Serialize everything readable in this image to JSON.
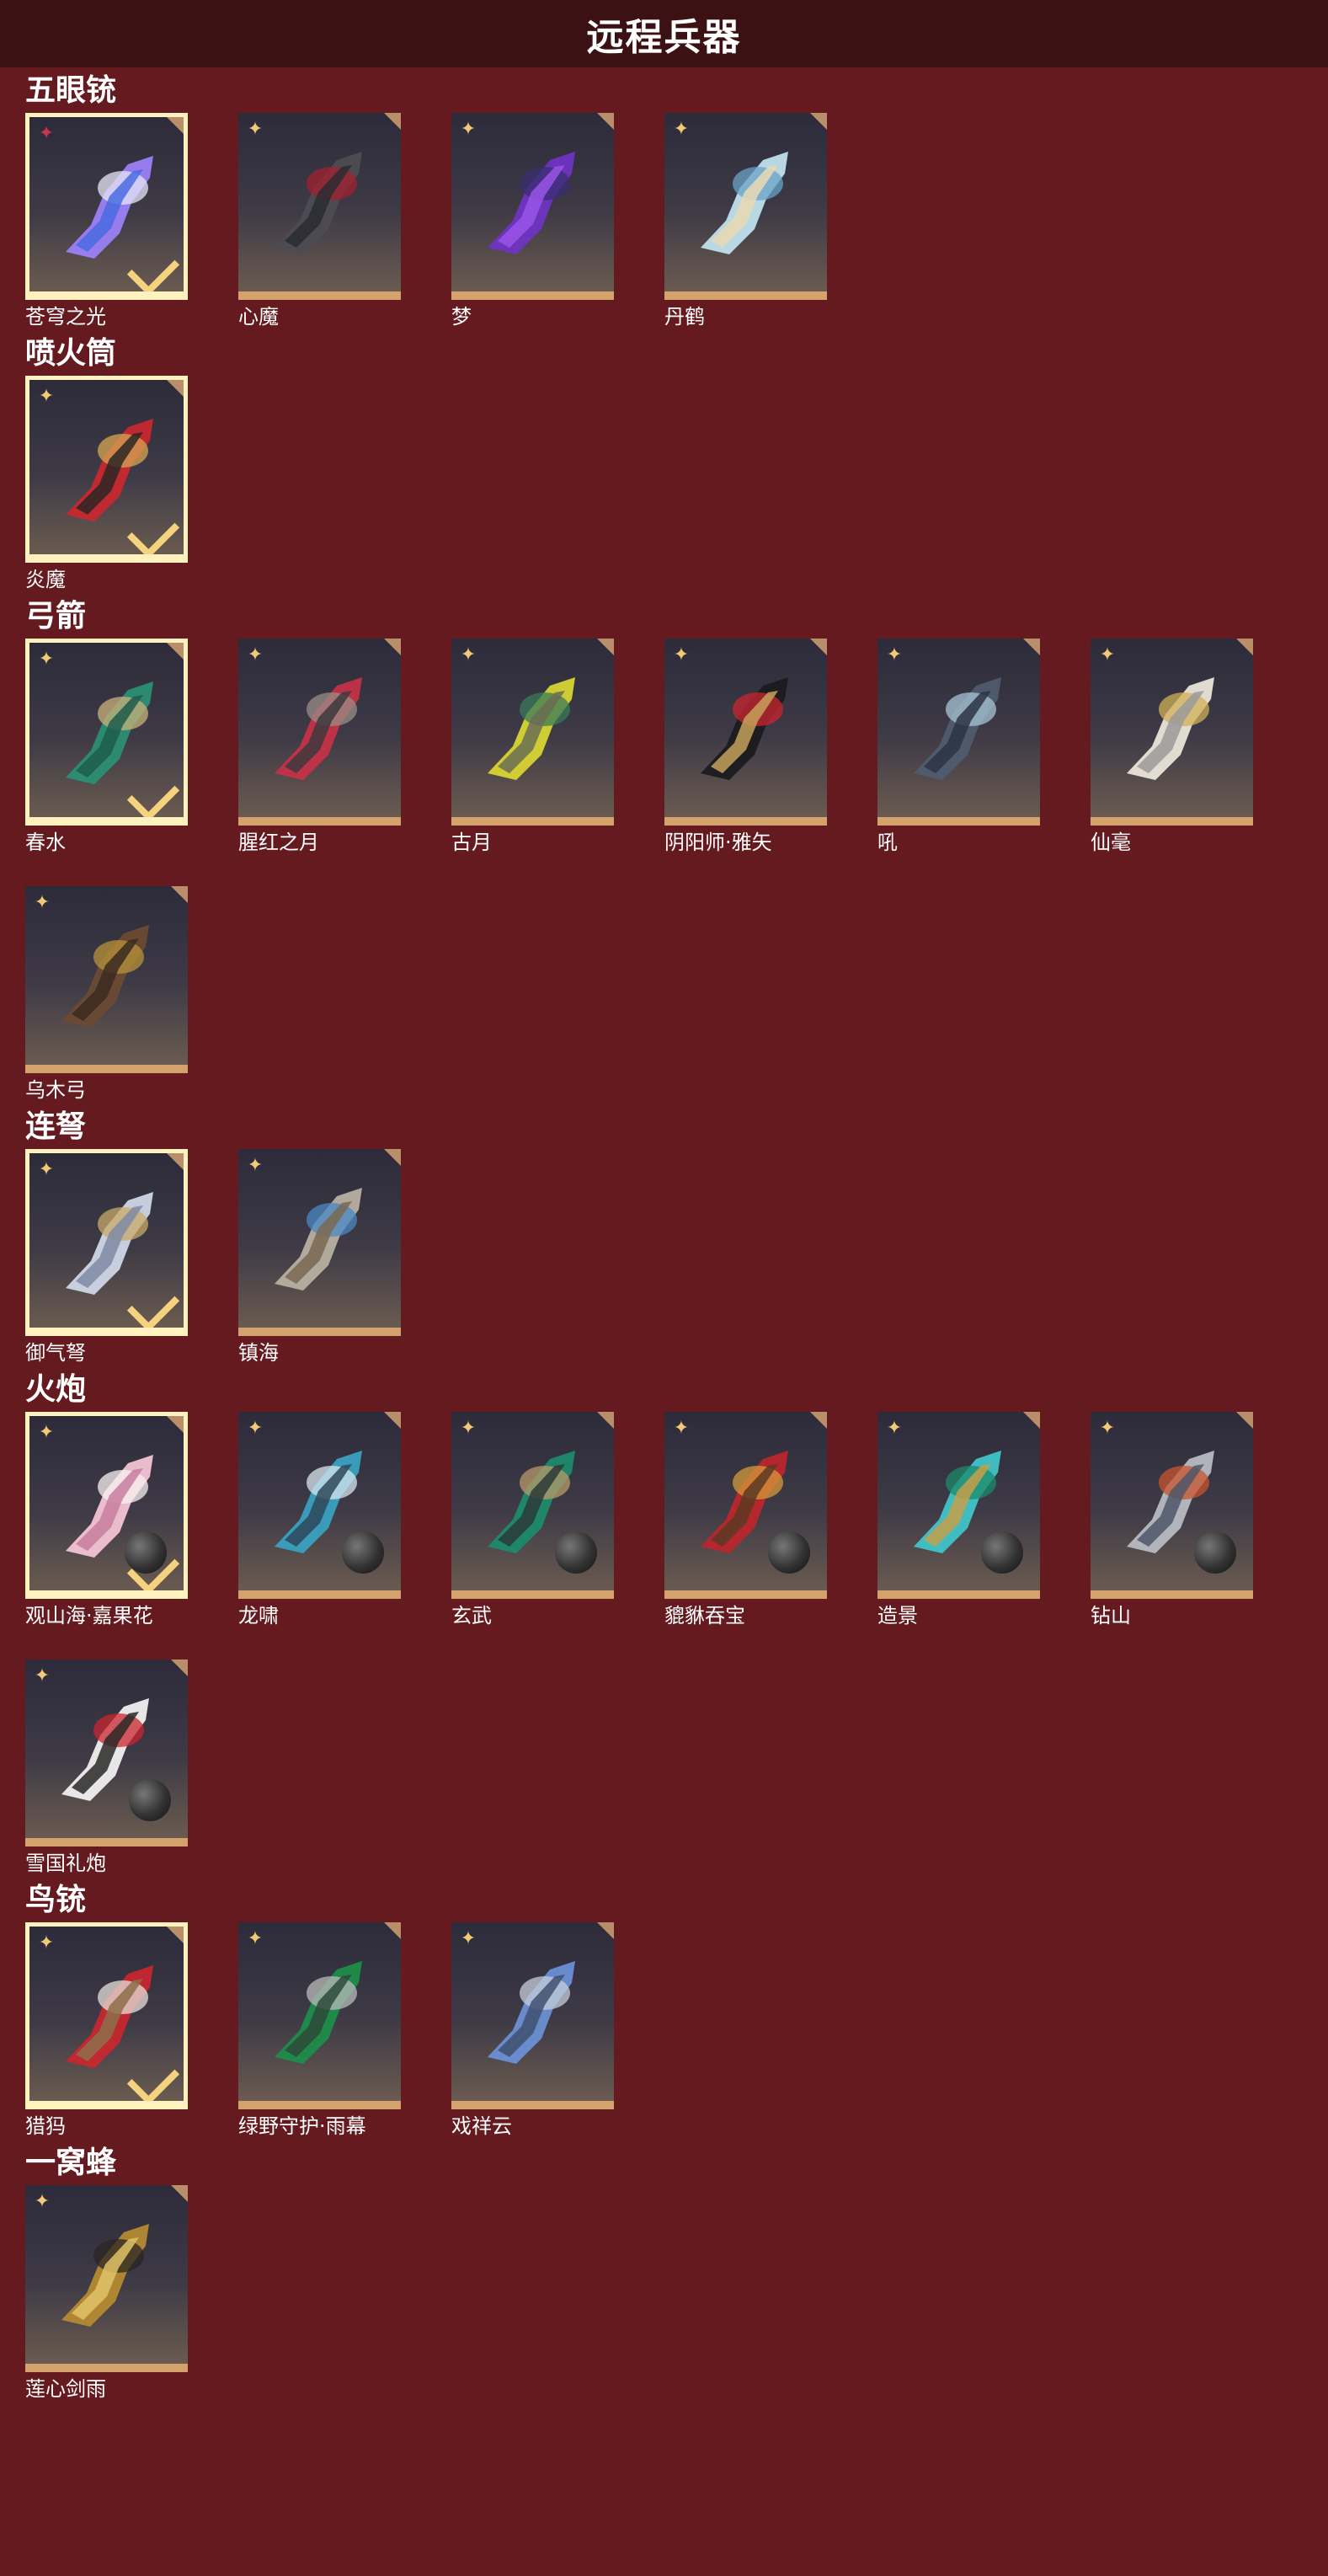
{
  "header": {
    "title": "远程兵器"
  },
  "sections": [
    {
      "title": "五眼铳",
      "items": [
        {
          "name": "苍穹之光",
          "selected": true,
          "badge": "red",
          "ammo": false,
          "art": [
            "#9b7ff5",
            "#e6e7f7",
            "#4a6be0"
          ]
        },
        {
          "name": "心魔",
          "selected": false,
          "badge": "gold",
          "ammo": false,
          "art": [
            "#4c4c52",
            "#a12030",
            "#2a2b30"
          ]
        },
        {
          "name": "梦",
          "selected": false,
          "badge": "gold",
          "ammo": false,
          "art": [
            "#6f34c2",
            "#3a2d6f",
            "#9a55e7"
          ]
        },
        {
          "name": "丹鹤",
          "selected": false,
          "badge": "gold",
          "ammo": false,
          "art": [
            "#bfe0ec",
            "#6aa3c7",
            "#e9d9b3"
          ]
        }
      ]
    },
    {
      "title": "喷火筒",
      "items": [
        {
          "name": "炎魔",
          "selected": true,
          "badge": "gold",
          "ammo": false,
          "art": [
            "#c7282f",
            "#d7a552",
            "#2c2623"
          ]
        }
      ]
    },
    {
      "title": "弓箭",
      "items": [
        {
          "name": "春水",
          "selected": true,
          "badge": "gold",
          "ammo": false,
          "art": [
            "#2b8f72",
            "#c9b07a",
            "#1d5c4b"
          ]
        },
        {
          "name": "腥红之月",
          "selected": false,
          "badge": "gold",
          "ammo": false,
          "art": [
            "#c43248",
            "#9a8e87",
            "#3d3a3d"
          ]
        },
        {
          "name": "古月",
          "selected": false,
          "badge": "gold",
          "ammo": false,
          "art": [
            "#d8d433",
            "#3a7a5a",
            "#6a6d52"
          ]
        },
        {
          "name": "阴阳师·雅矢",
          "selected": false,
          "badge": "gold",
          "ammo": false,
          "art": [
            "#1b1b1f",
            "#c9262f",
            "#c6a15b"
          ]
        },
        {
          "name": "吼",
          "selected": false,
          "badge": "gold",
          "ammo": false,
          "art": [
            "#4f5c6e",
            "#a7c4d6",
            "#2b3444"
          ]
        },
        {
          "name": "仙毫",
          "selected": false,
          "badge": "gold",
          "ammo": false,
          "art": [
            "#eae5d8",
            "#d0b058",
            "#9a9a9a"
          ]
        },
        {
          "name": "乌木弓",
          "selected": false,
          "badge": "gold",
          "ammo": false,
          "art": [
            "#6a4a33",
            "#b8923a",
            "#3b2a20"
          ]
        }
      ]
    },
    {
      "title": "连弩",
      "items": [
        {
          "name": "御气弩",
          "selected": true,
          "badge": "gold",
          "ammo": false,
          "art": [
            "#cfd6e6",
            "#c9a968",
            "#7f8aa3"
          ]
        },
        {
          "name": "镇海",
          "selected": false,
          "badge": "gold",
          "ammo": false,
          "art": [
            "#b7b0a1",
            "#4a88c4",
            "#7a6852"
          ]
        }
      ]
    },
    {
      "title": "火炮",
      "items": [
        {
          "name": "观山海·嘉果花",
          "selected": true,
          "badge": "gold",
          "ammo": true,
          "art": [
            "#f3c4d4",
            "#f7f1f1",
            "#c77ea0"
          ]
        },
        {
          "name": "龙啸",
          "selected": false,
          "badge": "gold",
          "ammo": true,
          "art": [
            "#3aa0c0",
            "#d7e6ee",
            "#2f4858"
          ]
        },
        {
          "name": "玄武",
          "selected": false,
          "badge": "gold",
          "ammo": true,
          "art": [
            "#1e8a6c",
            "#b89a6a",
            "#2a3a38"
          ]
        },
        {
          "name": "貔貅吞宝",
          "selected": false,
          "badge": "gold",
          "ammo": true,
          "art": [
            "#b9262c",
            "#d49a3a",
            "#5a3a22"
          ]
        },
        {
          "name": "造景",
          "selected": false,
          "badge": "gold",
          "ammo": true,
          "art": [
            "#40c4c8",
            "#1c8a6a",
            "#c6a04a"
          ]
        },
        {
          "name": "钻山",
          "selected": false,
          "badge": "gold",
          "ammo": true,
          "art": [
            "#b7bac2",
            "#c7542d",
            "#4e5668"
          ]
        },
        {
          "name": "雪国礼炮",
          "selected": false,
          "badge": "gold",
          "ammo": true,
          "art": [
            "#f0f0f0",
            "#c9262f",
            "#2a2826"
          ]
        }
      ]
    },
    {
      "title": "鸟铳",
      "items": [
        {
          "name": "猎犸",
          "selected": true,
          "badge": "gold",
          "ammo": false,
          "art": [
            "#c7272f",
            "#e5e0d8",
            "#8d6d4a"
          ]
        },
        {
          "name": "绿野守护·雨幕",
          "selected": false,
          "badge": "gold",
          "ammo": false,
          "art": [
            "#1e8d4a",
            "#b9b9b9",
            "#2e4a3a"
          ]
        },
        {
          "name": "戏祥云",
          "selected": false,
          "badge": "gold",
          "ammo": false,
          "art": [
            "#6c8fd4",
            "#c6ceda",
            "#40506e"
          ]
        }
      ]
    },
    {
      "title": "一窝蜂",
      "items": [
        {
          "name": "莲心剑雨",
          "selected": false,
          "badge": "gold",
          "ammo": false,
          "art": [
            "#b48a32",
            "#2a2523",
            "#e1c36a"
          ]
        }
      ]
    }
  ]
}
